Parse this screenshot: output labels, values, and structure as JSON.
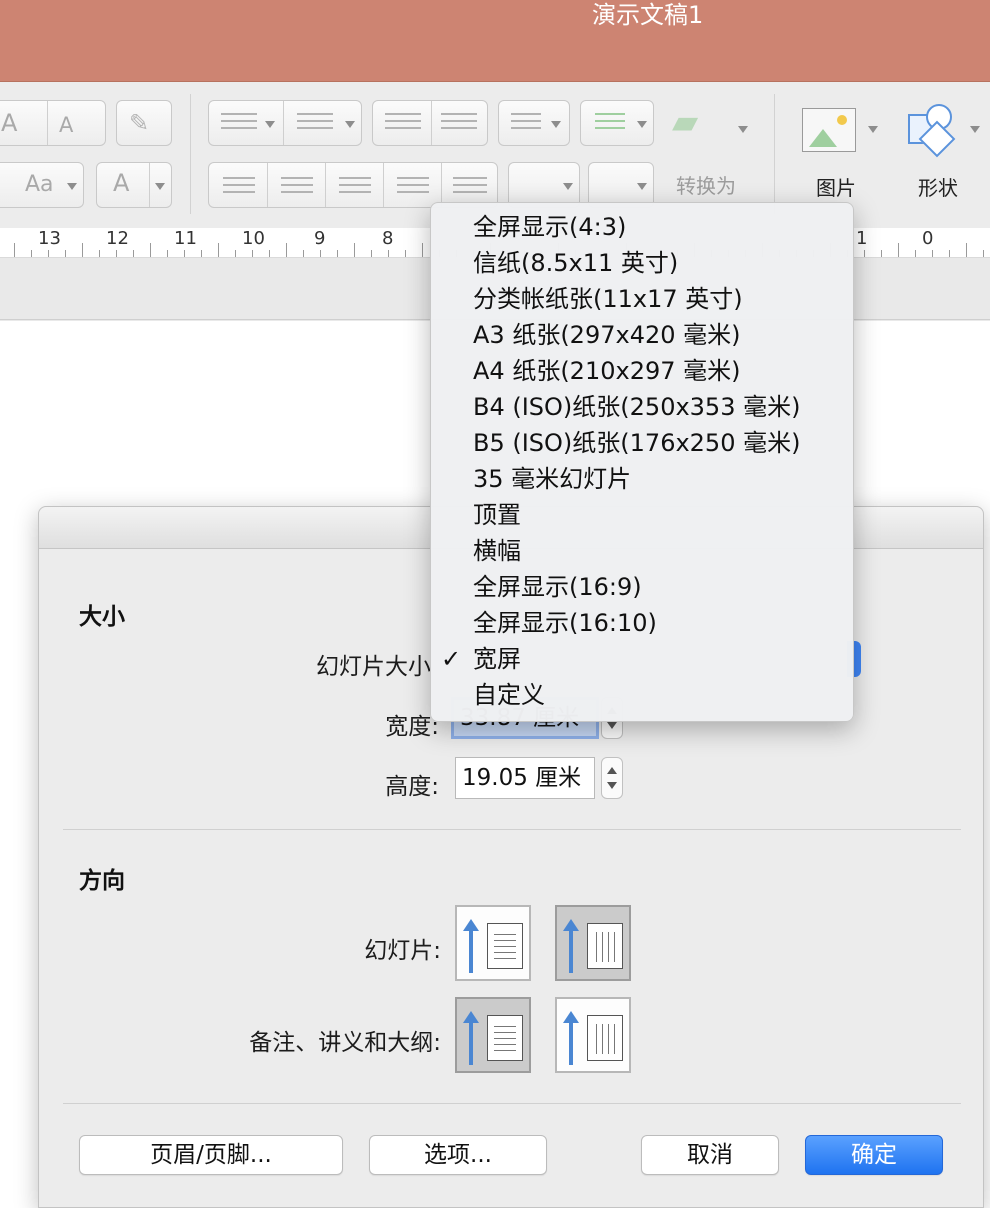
{
  "window": {
    "title": "演示文稿1"
  },
  "ribbon": {
    "font_increase": "A",
    "font_decrease": "A",
    "font_color": "A",
    "change_case": "Aa",
    "convert_label": "转换为",
    "picture_label": "图片",
    "shape_label": "形状"
  },
  "ruler": {
    "numbers": [
      "13",
      "12",
      "11",
      "10",
      "9",
      "8",
      "1",
      "0"
    ]
  },
  "dialog": {
    "size_section": "大小",
    "slide_size_label": "幻灯片大小",
    "width_label": "宽度:",
    "width_value": "33.87 厘米",
    "height_label": "高度:",
    "height_value": "19.05 厘米",
    "orientation_section": "方向",
    "slides_label": "幻灯片:",
    "notes_label": "备注、讲义和大纲:",
    "header_footer_button": "页眉/页脚...",
    "options_button": "选项...",
    "cancel_button": "取消",
    "ok_button": "确定"
  },
  "slide_size_menu": {
    "items": [
      {
        "label": "全屏显示(4:3)",
        "checked": false
      },
      {
        "label": "信纸(8.5x11 英寸)",
        "checked": false
      },
      {
        "label": "分类帐纸张(11x17 英寸)",
        "checked": false
      },
      {
        "label": "A3 纸张(297x420 毫米)",
        "checked": false
      },
      {
        "label": "A4 纸张(210x297 毫米)",
        "checked": false
      },
      {
        "label": "B4 (ISO)纸张(250x353 毫米)",
        "checked": false
      },
      {
        "label": "B5 (ISO)纸张(176x250 毫米)",
        "checked": false
      },
      {
        "label": "35 毫米幻灯片",
        "checked": false
      },
      {
        "label": "顶置",
        "checked": false
      },
      {
        "label": "横幅",
        "checked": false
      },
      {
        "label": "全屏显示(16:9)",
        "checked": false
      },
      {
        "label": "全屏显示(16:10)",
        "checked": false
      },
      {
        "label": "宽屏",
        "checked": true
      },
      {
        "label": "自定义",
        "checked": false
      }
    ],
    "check_mark": "✓"
  }
}
